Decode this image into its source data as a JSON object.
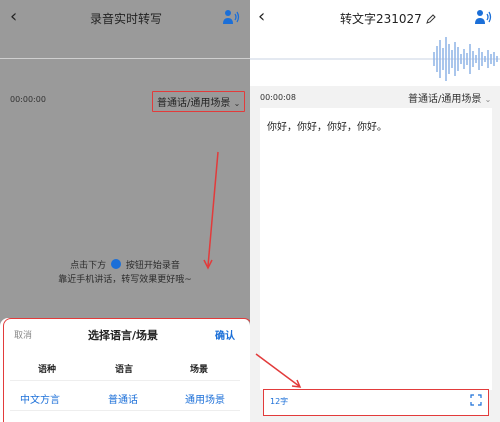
{
  "left": {
    "nav": {
      "back_glyph": "‹",
      "title": "录音实时转写",
      "speaker_icon": "speaker-person-icon"
    },
    "time": "00:00:00",
    "scene_chip": "普通话/通用场景",
    "hint_line1_pre": "点击下方",
    "hint_line1_post": "按钮开始录音",
    "hint_line2": "靠近手机讲话，转写效果更好哦~",
    "sheet": {
      "cancel": "取消",
      "title": "选择语言/场景",
      "confirm": "确认",
      "headers": [
        "语种",
        "语言",
        "场景"
      ],
      "options": [
        "中文方言",
        "普通话",
        "通用场景"
      ]
    }
  },
  "right": {
    "nav": {
      "back_glyph": "‹",
      "title": "转文字231027",
      "edit_icon": "pencil-icon",
      "speaker_icon": "speaker-person-icon"
    },
    "time": "00:00:08",
    "scene": "普通话/通用场景",
    "transcript": "你好，你好，你好，你好。",
    "word_count": "12字",
    "expand_icon": "expand-icon"
  },
  "colors": {
    "accent": "#1b6fd8",
    "highlight": "#e23b3b"
  }
}
